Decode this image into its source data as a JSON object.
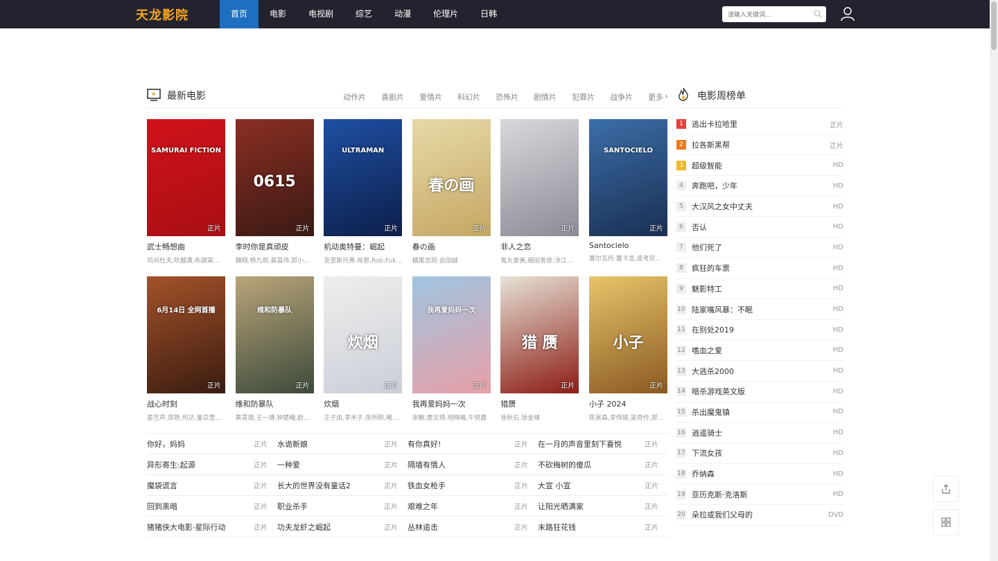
{
  "header": {
    "logo": "天龙影院",
    "nav": [
      "首页",
      "电影",
      "电视剧",
      "综艺",
      "动漫",
      "伦理片",
      "日韩"
    ],
    "active_index": 0,
    "search_placeholder": "请输入关键词..."
  },
  "section": {
    "title": "最新电影",
    "categories": [
      "动作片",
      "喜剧片",
      "爱情片",
      "科幻片",
      "恐怖片",
      "剧情片",
      "犯罪片",
      "战争片"
    ],
    "more_label": "更多"
  },
  "movies": [
    {
      "title": "武士畅想曲",
      "cast": "风间杜夫,吹越满,布袋寅泰...",
      "badge": "正片",
      "poster_text": "SAMURAI FICTION",
      "colors": [
        "#d1121a",
        "#a80f14"
      ]
    },
    {
      "title": "李时你是真顽皮",
      "cast": "魏翔,杨九郎,裴晨伟,郭小...",
      "badge": "正片",
      "poster_text": "0615",
      "colors": [
        "#8a2e23",
        "#3a1a14"
      ]
    },
    {
      "title": "机动奥特曼：崛起",
      "cast": "克里斯托弗·肖恩,Rob,Fuk...",
      "badge": "正片",
      "poster_text": "ULTRAMAN",
      "colors": [
        "#1e4fa3",
        "#0d1f4a"
      ]
    },
    {
      "title": "春の画",
      "cast": "橘尾忠则,会田誠",
      "badge": "正片",
      "poster_text": "春の画",
      "colors": [
        "#e8d9a8",
        "#c4a764"
      ]
    },
    {
      "title": "非人之恋",
      "cast": "兔丸爱美,细田善彦,涉江让...",
      "badge": "正片",
      "poster_text": "",
      "colors": [
        "#d8d8dc",
        "#8d8b95"
      ]
    },
    {
      "title": "Santocielo",
      "cast": "塞尔瓦托·塞卡龙,皮考尼...",
      "badge": "正片",
      "poster_text": "SANTOCIELO",
      "colors": [
        "#3b6ea8",
        "#1a2f52"
      ]
    },
    {
      "title": "战心时刻",
      "cast": "姜艺声,郭艳,何达,董苡萱...",
      "badge": "正片",
      "poster_text": "6月14日 全网首播",
      "colors": [
        "#a4522a",
        "#3a1c10"
      ]
    },
    {
      "title": "维和防暴队",
      "cast": "黄景瑜,王一博,钟楚曦,欧...",
      "badge": "正片",
      "poster_text": "维和防暴队",
      "colors": [
        "#b9a57a",
        "#3c4a3a"
      ]
    },
    {
      "title": "炊烟",
      "cast": "王子由,李木子,张所刚,褚...",
      "badge": "正片",
      "poster_text": "炊烟",
      "colors": [
        "#f0eeec",
        "#c9cfd8"
      ]
    },
    {
      "title": "我再爱妈妈一次",
      "cast": "张敏,唐文琦,明晓曦,牛悦鑫",
      "badge": "正片",
      "poster_text": "我再爱妈妈一次",
      "colors": [
        "#9fc4e0",
        "#e8a0a8"
      ]
    },
    {
      "title": "猎赝",
      "cast": "徐秋石,徐金峰",
      "badge": "正片",
      "poster_text": "猎 赝",
      "colors": [
        "#e7e2d6",
        "#8c1c14"
      ]
    },
    {
      "title": "小子 2024",
      "cast": "陈昊森,李伟瑜,吴奇伶,郑...",
      "badge": "正片",
      "poster_text": "小子",
      "colors": [
        "#e8c46a",
        "#8a5a22"
      ]
    }
  ],
  "text_list": [
    [
      {
        "name": "你好，妈妈",
        "q": "正片"
      },
      {
        "name": "水诡新娘",
        "q": "正片"
      },
      {
        "name": "有你真好!",
        "q": "正片"
      },
      {
        "name": "在一月的声音里刻下喜悦",
        "q": "正片"
      }
    ],
    [
      {
        "name": "异形寄生:起源",
        "q": "正片"
      },
      {
        "name": "一种爱",
        "q": "正片"
      },
      {
        "name": "隔墙有情人",
        "q": "正片"
      },
      {
        "name": "不砍梅树的傻瓜",
        "q": "正片"
      }
    ],
    [
      {
        "name": "魔袋谎言",
        "q": "正片"
      },
      {
        "name": "长大的世界没有童话2",
        "q": "正片"
      },
      {
        "name": "铁血女枪手",
        "q": "正片"
      },
      {
        "name": "大宣 小宣",
        "q": "正片"
      }
    ],
    [
      {
        "name": "回到黑暗",
        "q": "正片"
      },
      {
        "name": "职业杀手",
        "q": "正片"
      },
      {
        "name": "艰难之年",
        "q": "正片"
      },
      {
        "name": "让阳光晒满家",
        "q": "正片"
      }
    ],
    [
      {
        "name": "猪猪侠大电影·星际行动",
        "q": "正片"
      },
      {
        "name": "功夫龙虾之崛起",
        "q": "正片"
      },
      {
        "name": "丛林追击",
        "q": "正片"
      },
      {
        "name": "末路狂花钱",
        "q": "正片"
      }
    ]
  ],
  "ranking": {
    "title": "电影周榜单",
    "top_colors": [
      "#e8403a",
      "#f07a1a",
      "#f5b721"
    ],
    "items": [
      {
        "rank": "1",
        "name": "逃出卡拉哈里",
        "q": "正片"
      },
      {
        "rank": "2",
        "name": "拉各斯黑帮",
        "q": "正片"
      },
      {
        "rank": "3",
        "name": "超级智能",
        "q": "HD"
      },
      {
        "rank": "4",
        "name": "奔跑吧，少年",
        "q": "HD"
      },
      {
        "rank": "5",
        "name": "大汉风之女中丈夫",
        "q": "HD"
      },
      {
        "rank": "6",
        "name": "否认",
        "q": "HD"
      },
      {
        "rank": "7",
        "name": "他们死了",
        "q": "HD"
      },
      {
        "rank": "8",
        "name": "疯狂的车票",
        "q": "HD"
      },
      {
        "rank": "9",
        "name": "魅影特工",
        "q": "HD"
      },
      {
        "rank": "10",
        "name": "陆家嘴风暴：不眠",
        "q": "HD"
      },
      {
        "rank": "11",
        "name": "在别处2019",
        "q": "HD"
      },
      {
        "rank": "12",
        "name": "嗜血之爱",
        "q": "HD"
      },
      {
        "rank": "13",
        "name": "大逃杀2000",
        "q": "HD"
      },
      {
        "rank": "14",
        "name": "暗杀游戏英文版",
        "q": "HD"
      },
      {
        "rank": "15",
        "name": "杀出魔鬼镇",
        "q": "HD"
      },
      {
        "rank": "16",
        "name": "逍遥骑士",
        "q": "HD"
      },
      {
        "rank": "17",
        "name": "下流女孩",
        "q": "HD"
      },
      {
        "rank": "18",
        "name": "乔纳森",
        "q": "HD"
      },
      {
        "rank": "19",
        "name": "亚历克斯·克洛斯",
        "q": "HD"
      },
      {
        "rank": "20",
        "name": "朵拉或我们父母的",
        "q": "DVD"
      }
    ]
  },
  "icons": {
    "search": "search-icon",
    "user": "user-icon",
    "share": "share-icon",
    "qrcode": "qrcode-icon",
    "tv": "tv-icon",
    "fire": "fire-icon"
  }
}
